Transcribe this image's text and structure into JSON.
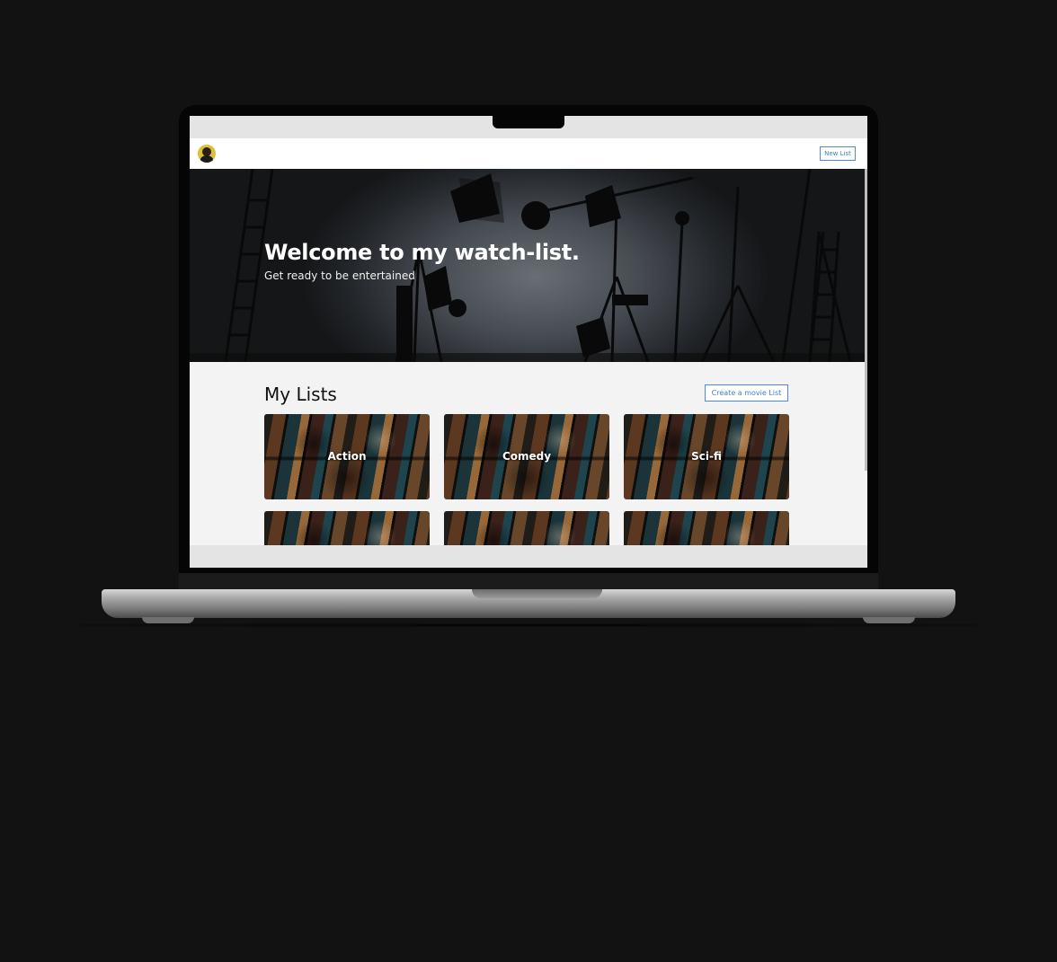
{
  "nav": {
    "new_list_label": "New List"
  },
  "hero": {
    "title": "Welcome to my watch-list.",
    "subtitle": "Get ready to be entertained"
  },
  "lists_section": {
    "title": "My Lists",
    "create_label": "Create a movie List",
    "cards": [
      {
        "label": "Action"
      },
      {
        "label": "Comedy"
      },
      {
        "label": "Sci-fi"
      },
      {
        "label": ""
      },
      {
        "label": ""
      },
      {
        "label": ""
      }
    ]
  },
  "colors": {
    "page_background": "#121212",
    "accent_blue": "#4d8ad8",
    "content_background": "#f3f3f3"
  }
}
